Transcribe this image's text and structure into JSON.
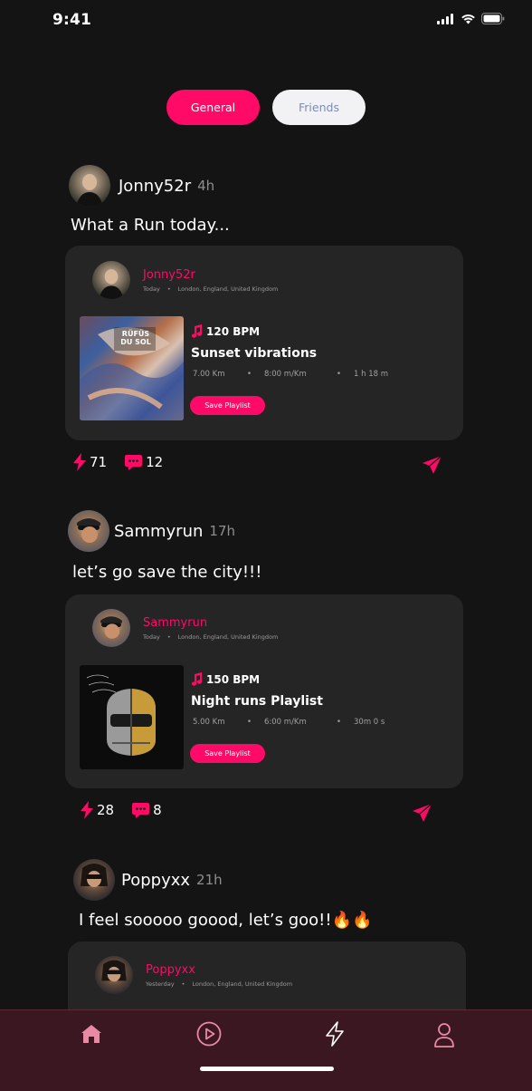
{
  "status_bar": {
    "time": "9:41"
  },
  "tabs": [
    {
      "label": "General",
      "active": true
    },
    {
      "label": "Friends",
      "active": false
    }
  ],
  "posts": [
    {
      "user": "Jonny52r",
      "time": "4h",
      "caption": "What a Run today...",
      "card": {
        "user": "Jonny52r",
        "day": "Today",
        "location": "London, England, United Kingdom",
        "bpm": "120 BPM",
        "title": "Sunset vibrations",
        "distance": "7.00 Km",
        "pace": "8:00 m/Km",
        "duration": "1 h 18 m",
        "save_label": "Save Playlist",
        "album_text": "RÜFÜS DU SOL"
      },
      "likes": "71",
      "comments": "12"
    },
    {
      "user": "Sammyrun",
      "time": "17h",
      "caption": "let’s go save the city!!!",
      "card": {
        "user": "Sammyrun",
        "day": "Today",
        "location": "London, England, United Kingdom",
        "bpm": "150 BPM",
        "title": "Night runs Playlist",
        "distance": "5.00 Km",
        "pace": "6:00 m/Km",
        "duration": "30m 0 s",
        "save_label": "Save Playlist"
      },
      "likes": "28",
      "comments": "8"
    },
    {
      "user": "Poppyxx",
      "time": "21h",
      "caption": "I feel sooooo goood, let’s goo!!🔥🔥",
      "card": {
        "user": "Poppyxx",
        "day": "Yesterday",
        "location": "London, England, United Kingdom"
      }
    }
  ],
  "nav": {
    "items": [
      "home-icon",
      "play-icon",
      "activity-icon",
      "profile-icon"
    ],
    "active": "home-icon"
  },
  "colors": {
    "accent": "#ff0a66",
    "background": "#141414",
    "card": "#252525",
    "nav": "#3a1721"
  }
}
